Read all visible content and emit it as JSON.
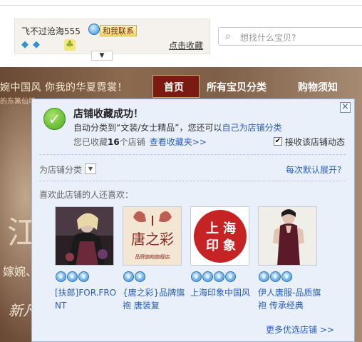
{
  "shop": {
    "name": "飞不过沧海555",
    "contact_label": "和我联系",
    "favorite_link": "点击收藏",
    "dropdown_icon": "chevron-down-icon",
    "rank_icons": [
      "diamond-icon",
      "diamond-icon",
      "leaf-icon"
    ]
  },
  "search": {
    "placeholder": "想找什么宝贝?"
  },
  "banner": {
    "slogan": "婉中国风  你我的华夏霓裳！",
    "sub": "的东篱仙境",
    "big_char": "江",
    "left_text_1": "嫁婉、",
    "left_text_2": "新凡"
  },
  "nav": {
    "items": [
      "首页",
      "所有宝贝分类",
      "购物须知"
    ]
  },
  "popup": {
    "title": "店铺收藏成功！",
    "line1_prefix": "自动分类到“文装/女士精品”，您还可以",
    "line1_link": "自己为店铺分类",
    "line2_prefix": "您已收藏",
    "line2_count": "16",
    "line2_suffix": "个店铺",
    "line2_link": "查看收藏夹>>",
    "subscribe_label": "接收该店铺动态",
    "subscribe_checked": true,
    "category_label": "为店铺分类",
    "expand_label": "每次默认展开?",
    "also_like": "喜欢此店铺的人还喜欢：",
    "recommendations": [
      {
        "title": "[扶郎]FOR.FRONT",
        "crowns": 3
      },
      {
        "title": "{唐之彩}品牌旗袍 唐装复",
        "crowns": 2
      },
      {
        "title": "上海印象中国风",
        "crowns": 4
      },
      {
        "title": "伊人唐服-品质旗袍 传承经典",
        "crowns": 3
      }
    ],
    "more_label": "更多优选店铺 >>"
  },
  "colors": {
    "link": "#2a5eb4",
    "nav_active": "#7a1a12",
    "popup_bg": "#e9f0fa"
  }
}
